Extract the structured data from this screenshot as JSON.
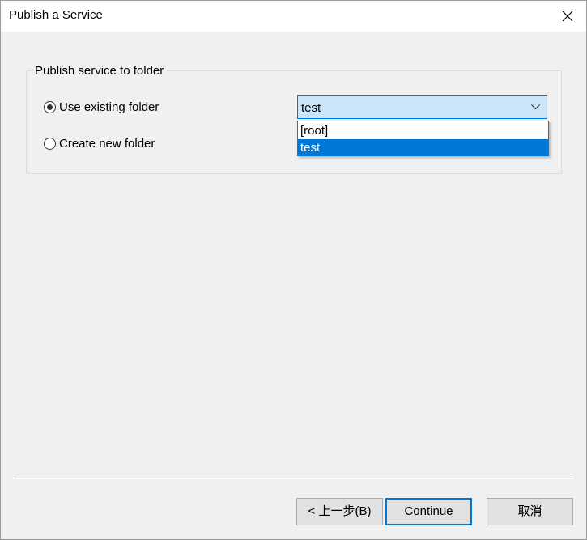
{
  "window": {
    "title": "Publish a Service"
  },
  "group": {
    "legend": "Publish service to folder"
  },
  "options": {
    "use_existing": {
      "label": "Use existing folder",
      "checked": true
    },
    "create_new": {
      "label": "Create new folder",
      "checked": false
    }
  },
  "folder_select": {
    "value": "test",
    "options": [
      "[root]",
      "test"
    ],
    "highlighted": "test"
  },
  "buttons": {
    "back": "< 上一步(B)",
    "continue": "Continue",
    "cancel": "取消"
  },
  "colors": {
    "accent": "#0078d7",
    "combo_bg": "#cce4f7",
    "dialog_bg": "#f0f0f0"
  },
  "icons": {
    "close": "close-icon",
    "dropdown": "chevron-down-icon"
  }
}
